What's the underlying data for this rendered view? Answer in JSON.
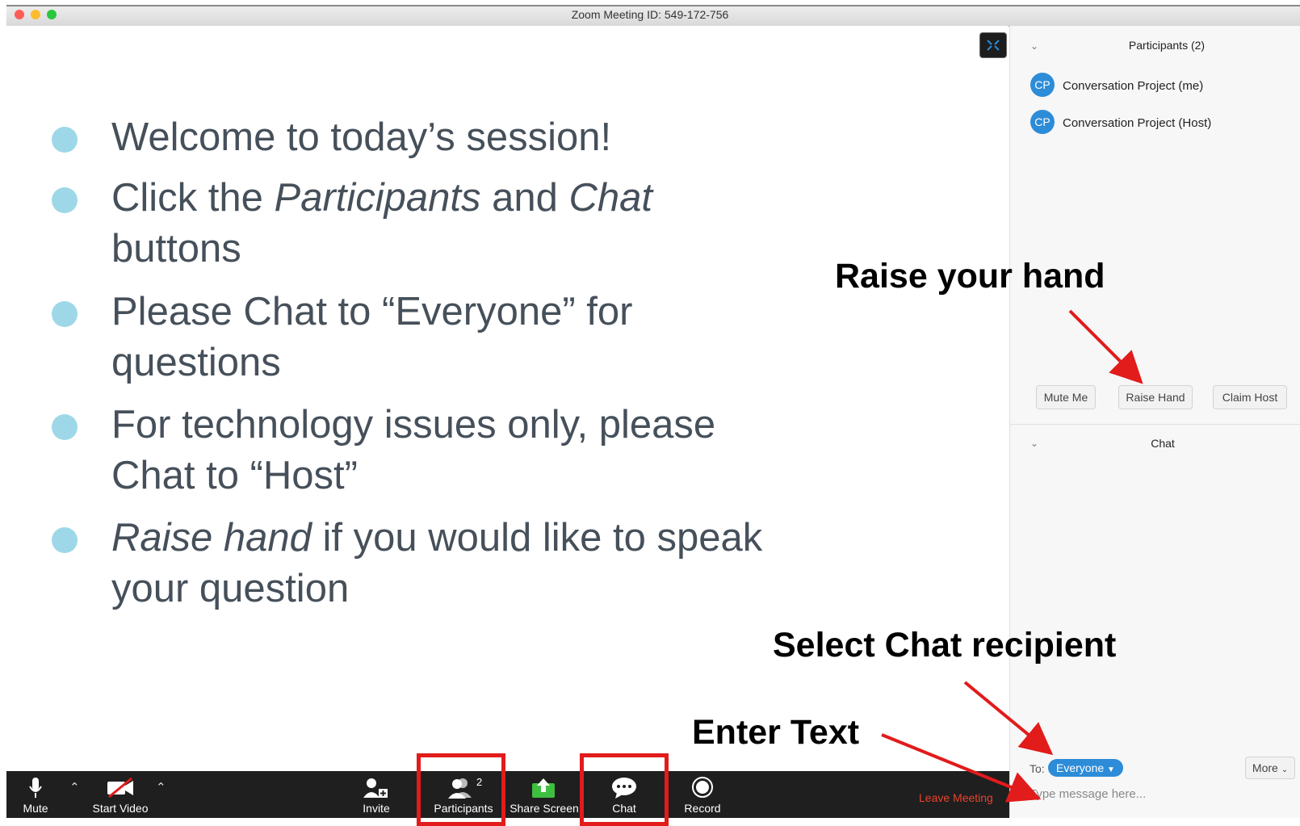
{
  "window": {
    "title": "Zoom Meeting ID: 549-172-756"
  },
  "slide": {
    "bullets": [
      {
        "line1": "Welcome to today’s session!"
      },
      {
        "p1": "Click the ",
        "p2": "Participants",
        "p3": " and ",
        "p4": "Chat",
        "line2": "buttons"
      },
      {
        "line1": "Please Chat to “Everyone” for",
        "line2": "questions"
      },
      {
        "line1": "For technology issues only, please",
        "line2": "Chat to “Host”"
      },
      {
        "p1": "Raise hand",
        "p2": " if you would like to speak",
        "line2": "your question"
      }
    ]
  },
  "participants_panel": {
    "header": "Participants (2)",
    "participants": [
      {
        "initials": "CP",
        "name": "Conversation Project (me)"
      },
      {
        "initials": "CP",
        "name": "Conversation Project (Host)"
      }
    ],
    "buttons": {
      "mute_me": "Mute Me",
      "raise_hand": "Raise Hand",
      "claim_host": "Claim Host"
    }
  },
  "chat_panel": {
    "header": "Chat",
    "to_label": "To:",
    "recipient": "Everyone",
    "more": "More",
    "placeholder": "Type message here..."
  },
  "toolbar": {
    "mute": "Mute",
    "start_video": "Start Video",
    "invite": "Invite",
    "participants": "Participants",
    "participants_count": "2",
    "share_screen": "Share Screen",
    "chat": "Chat",
    "record": "Record",
    "leave": "Leave Meeting"
  },
  "annotations": {
    "raise_hand": "Raise your hand",
    "select_recipient": "Select Chat recipient",
    "enter_text": "Enter Text"
  },
  "colors": {
    "accent_blue": "#2d8cd8",
    "annotation_red": "#e21b1b",
    "bullet": "#9ed8e8",
    "leave_red": "#e8432e",
    "share_green": "#3fbf3f"
  }
}
